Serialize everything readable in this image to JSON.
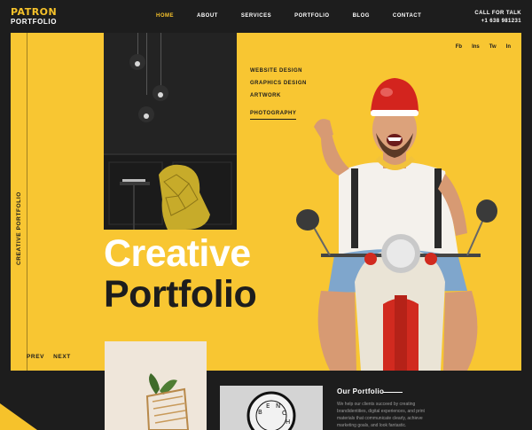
{
  "brand": {
    "line1": "PATRON",
    "line2": "PORTFOLIO"
  },
  "nav": {
    "items": [
      "HOME",
      "ABOUT",
      "SERVICES",
      "PORTFOLIO",
      "BLOG",
      "CONTACT"
    ],
    "active_index": 0
  },
  "contact": {
    "label": "CALL FOR TALK",
    "phone": "+1 638 981231"
  },
  "hero": {
    "vertical_label": "CREATIVE PORTFOLIO",
    "side_menu": [
      "WEBSITE DESIGN",
      "GRAPHICS DESIGN",
      "ARTWORK",
      "PHOTOGRAPHY"
    ],
    "social": [
      "Fb",
      "Ins",
      "Tw",
      "In"
    ],
    "title_line1": "Creative",
    "title_line2": "Portfolio",
    "prev_label": "PREV",
    "next_label": "NEXT"
  },
  "bottom": {
    "section_title": "Our Portfolio",
    "description": "We help our clients succeed by creating brandidentities, digital experiences, and print materials that communicate clearly, achieve marketing goals, and look fantastic."
  },
  "colors": {
    "accent": "#f6c22b",
    "hero_bg": "#f8c632",
    "dark": "#1d1d1d"
  }
}
